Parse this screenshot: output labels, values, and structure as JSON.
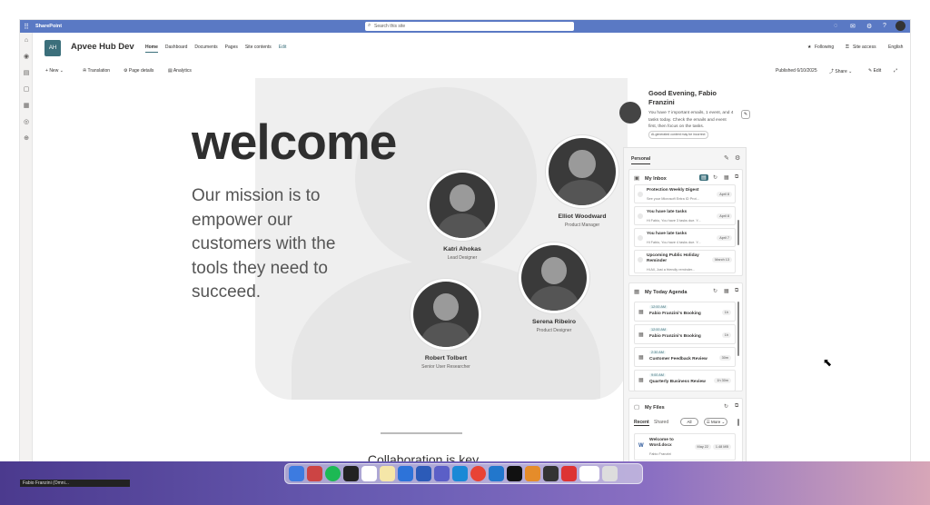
{
  "suite": {
    "brand": "SharePoint",
    "search_placeholder": "Search this site",
    "help": "?"
  },
  "site": {
    "logo": "AH",
    "name": "Apvee Hub Dev",
    "nav": [
      "Home",
      "Dashboard",
      "Documents",
      "Pages",
      "Site contents",
      "Edit"
    ],
    "following": "Following",
    "site_access": "Site access",
    "language": "English"
  },
  "cmdbar": {
    "new": "New",
    "translation": "Translation",
    "page_details": "Page details",
    "analytics": "Analytics",
    "published": "Published 6/10/2025",
    "share": "Share",
    "edit": "Edit"
  },
  "hero": {
    "welcome": "welcome",
    "mission": "Our mission is to empower our customers with the tools they need to succeed."
  },
  "team": [
    {
      "name": "Katri Ahokas",
      "role": "Lead Designer"
    },
    {
      "name": "Elliot Woodward",
      "role": "Product Manager"
    },
    {
      "name": "Serena Ribeiro",
      "role": "Product Designer"
    },
    {
      "name": "Robert Tolbert",
      "role": "Senior User Researcher"
    }
  ],
  "collab": "Collaboration is key",
  "greeting": {
    "title": "Good Evening, Fabio Franzini",
    "message": "You have 7 important emails, 1 event, and 4 tasks today. Check the emails and event first, then focus on the tasks.",
    "ai_note": "AI-generated content may be incorrect"
  },
  "panel": {
    "tab": "Personal",
    "inbox": {
      "title": "My Inbox",
      "items": [
        {
          "title": "Protection Weekly Digest",
          "sub": "See your Microsoft Entra ID Prot...",
          "date": "April 8"
        },
        {
          "title": "You have late tasks",
          "sub": "Hi Fabio, You have 3 tasks due. Y...",
          "date": "April 8"
        },
        {
          "title": "You have late tasks",
          "sub": "Hi Fabio, You have 4 tasks due. Y...",
          "date": "April 7"
        },
        {
          "title": "Upcoming Public Holiday Reminder",
          "sub": "Hi All, Just a friendly reminder...",
          "date": "March 13"
        }
      ]
    },
    "agenda": {
      "title": "My Today Agenda",
      "items": [
        {
          "time": "12:00 AM",
          "title": "Fabio Franzini's Booking",
          "dur": "1h"
        },
        {
          "time": "12:00 AM",
          "title": "Fabio Franzini's Booking",
          "dur": "1h"
        },
        {
          "time": "2:30 AM",
          "title": "Customer Feedback Review",
          "dur": "30m"
        },
        {
          "time": "9:00 AM",
          "title": "Quarterly Business Review",
          "dur": "1h 30m"
        }
      ]
    },
    "files": {
      "title": "My Files",
      "tab_recent": "Recent",
      "tab_shared": "Shared",
      "filter_all": "All",
      "more": "More",
      "items": [
        {
          "name": "Welcome to Word.docx",
          "owner": "Fabio Franzini",
          "date": "May 22",
          "size": "1.48 MB"
        }
      ]
    }
  },
  "tooltip": "Fabio Franzini (Omni...",
  "colors": {
    "suitebar": "#5a79c4",
    "accent": "#3b6f7b"
  }
}
